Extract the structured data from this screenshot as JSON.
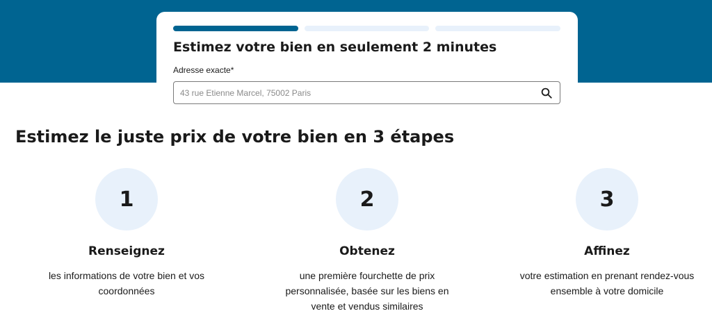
{
  "card": {
    "title": "Estimez votre bien en seulement 2 minutes",
    "progress": {
      "current_step": 1,
      "total_steps": 3
    },
    "address": {
      "label": "Adresse exacte",
      "required_marker": "*",
      "placeholder": "43 rue Etienne Marcel, 75002 Paris",
      "value": ""
    }
  },
  "section": {
    "title": "Estimez le juste prix de votre bien en 3 étapes"
  },
  "steps": [
    {
      "number": "1",
      "title": "Renseignez",
      "description": "les informations de votre bien et vos coordonnées"
    },
    {
      "number": "2",
      "title": "Obtenez",
      "description": "une première fourchette de prix personnalisée, basée sur les biens en vente et vendus similaires"
    },
    {
      "number": "3",
      "title": "Affinez",
      "description": "votre estimation en prenant rendez-vous ensemble à votre domicile"
    }
  ],
  "colors": {
    "brand": "#006491",
    "step_circle": "#e8f1fb",
    "progress_inactive": "#e8f1fb"
  }
}
